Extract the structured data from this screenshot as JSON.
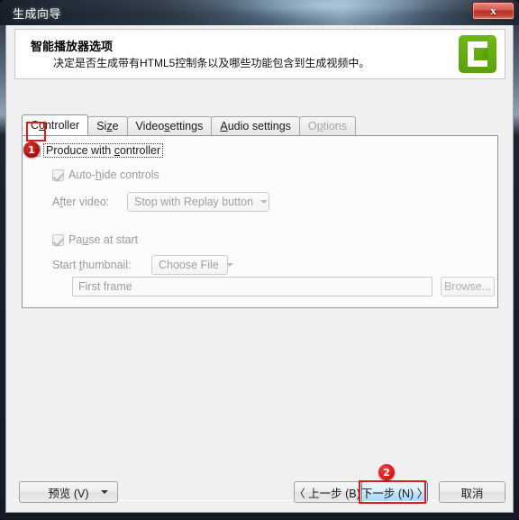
{
  "window": {
    "title": "生成向导",
    "close_label": "x"
  },
  "header": {
    "title": "智能播放器选项",
    "subtitle": "决定是否生成带有HTML5控制条以及哪些功能包含到生成视频中。",
    "logo_name": "camtasia-logo"
  },
  "tabs": [
    {
      "label": "Controller",
      "accel": "o",
      "active": true,
      "disabled": false
    },
    {
      "label": "Size",
      "accel": "z",
      "active": false,
      "disabled": false
    },
    {
      "label": "Video settings",
      "accel": "s",
      "active": false,
      "disabled": false
    },
    {
      "label": "Audio settings",
      "accel": "A",
      "active": false,
      "disabled": false
    },
    {
      "label": "Options",
      "accel": "p",
      "active": false,
      "disabled": true
    }
  ],
  "controller_panel": {
    "produce_with_controller": {
      "label": "Produce with controller",
      "checked": false,
      "focused": true
    },
    "auto_hide_controls": {
      "label": "Auto-hide controls",
      "checked": true,
      "disabled": true
    },
    "after_video": {
      "label": "After video:",
      "value": "Stop with Replay button"
    },
    "pause_at_start": {
      "label": "Pause at start",
      "checked": true,
      "disabled": true
    },
    "start_thumbnail": {
      "label": "Start thumbnail:",
      "value": "Choose File"
    },
    "thumbnail_path": {
      "value": "First frame"
    },
    "browse_button": {
      "label": "Browse..."
    }
  },
  "footer": {
    "preview": "预览 (V)",
    "back": "〈 上一步 (B)",
    "next": "下一步 (N) 〉",
    "cancel": "取消"
  },
  "annotations": [
    {
      "id": "1",
      "target": "produce-with-controller-checkbox"
    },
    {
      "id": "2",
      "target": "next-button"
    }
  ],
  "colors": {
    "accent_red": "#e01b1b",
    "brand_green": "#6fb813",
    "focus_blue": "#3c7fb1"
  }
}
